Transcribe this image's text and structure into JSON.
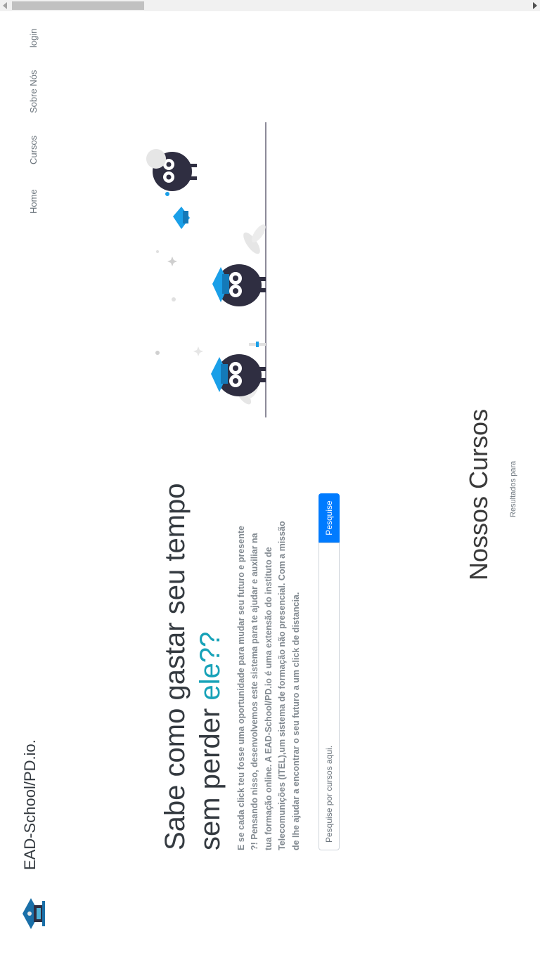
{
  "brand": {
    "name": "EAD-School/PD.io."
  },
  "nav": {
    "home": "Home",
    "cursos": "Cursos",
    "sobre": "Sobre Nós",
    "login": "login"
  },
  "hero": {
    "title_line1": "Sabe como gastar seu tempo",
    "title_line2_prefix": "sem perder ",
    "title_line2_accent": "ele??",
    "text": "E se cada click teu fosse uma oportunidade para mudar seu futuro e presente ?! Pensando nisso, desenvolvemos este sistema para te ajudar e auxiliar na tua formação online. A EAD-School/PD.io é uma extensão do instituto de Telecomunições (ITEL),um sistema de formação não presencial. Com a missão de lhe ajudar a encontrar o seu futuro a um click de distancia."
  },
  "search": {
    "placeholder": "Pesquise por cursos aqui.",
    "value": "",
    "button_label": "Pesquise"
  },
  "courses": {
    "title": "Nossos Cursos",
    "results_label": "Resultados para"
  },
  "colors": {
    "accent": "#17a2b8",
    "primary": "#007bff",
    "text": "#343a40",
    "muted": "#6c757d",
    "illustration_blue": "#1a9fe8",
    "illustration_dark": "#2f2e41"
  },
  "icons": {
    "logo": "school-logo-icon",
    "illustration": "graduation-owls-illustration"
  }
}
